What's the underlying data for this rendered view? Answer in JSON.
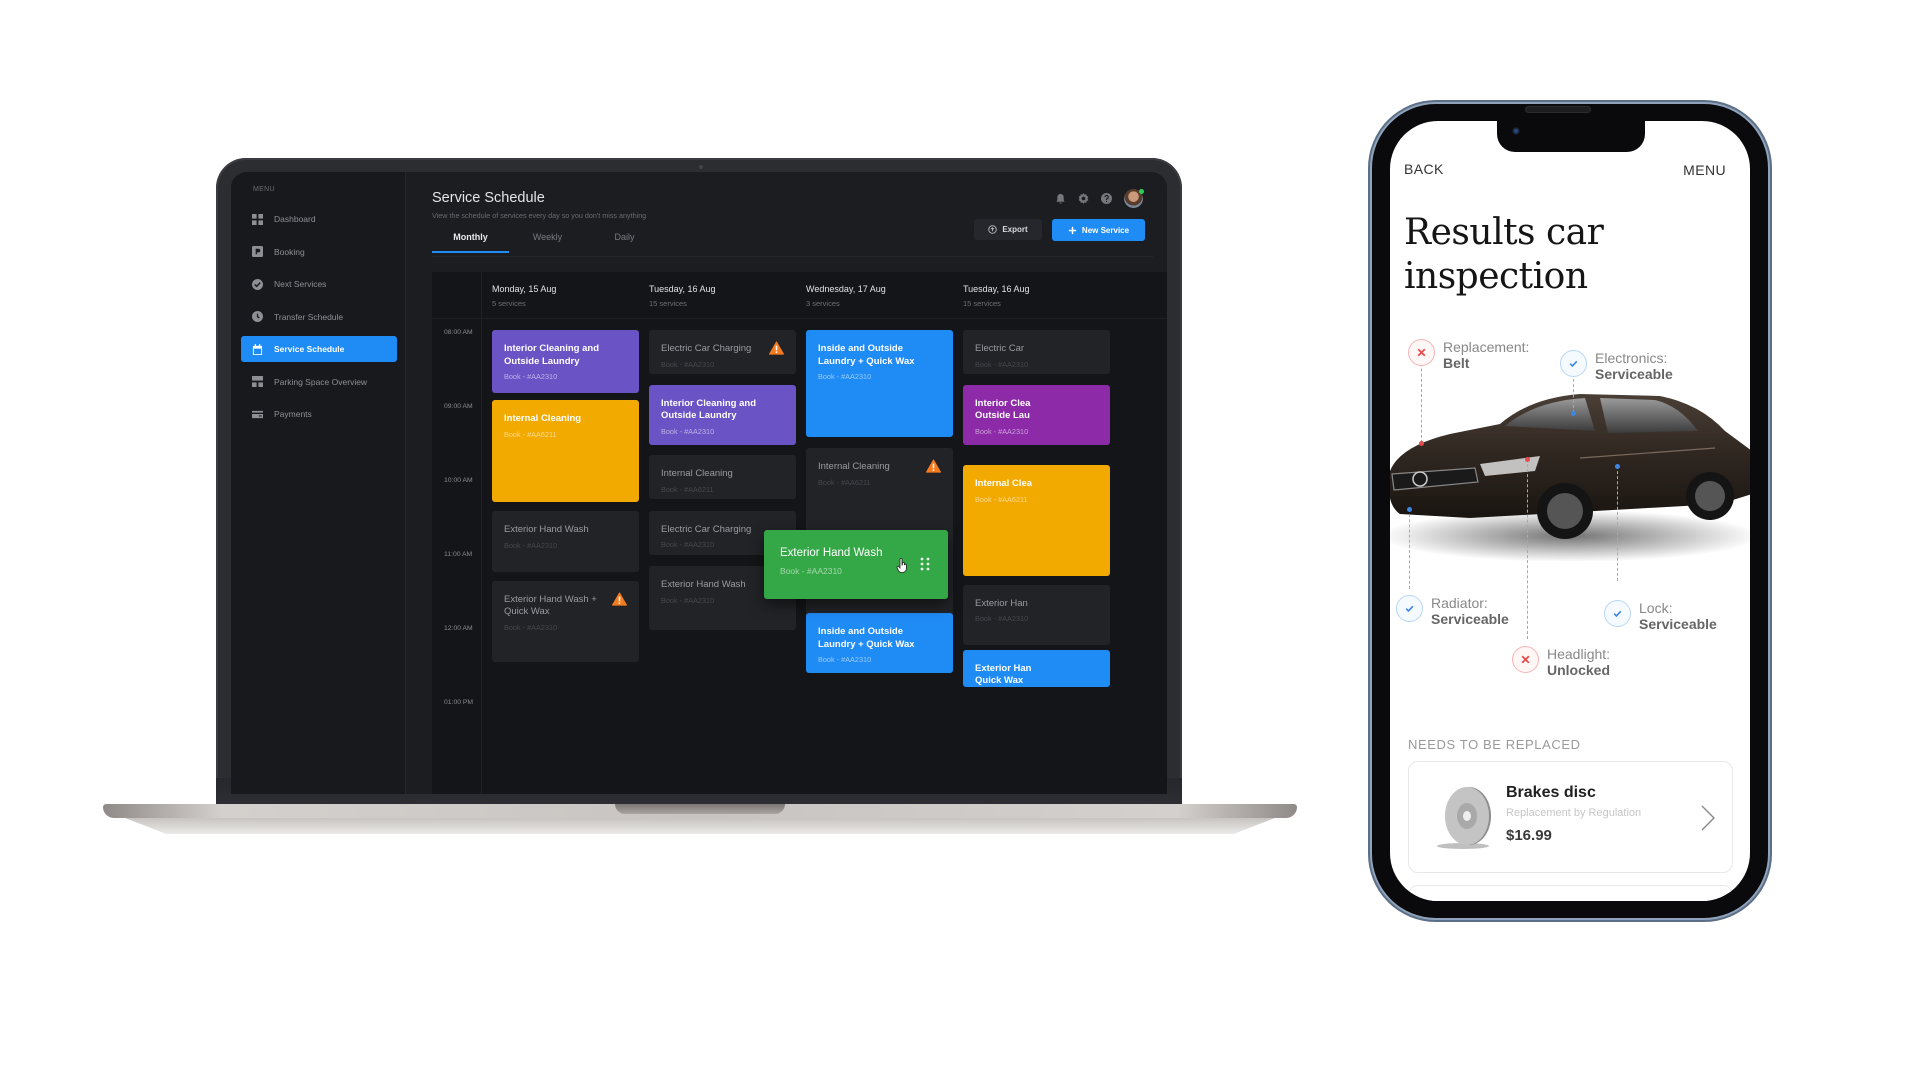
{
  "laptop": {
    "sidebar": {
      "caption": "MENU",
      "items": [
        {
          "label": "Dashboard",
          "icon": "grid-icon",
          "active": false
        },
        {
          "label": "Booking",
          "icon": "parking-icon",
          "active": false
        },
        {
          "label": "Next Services",
          "icon": "check-circle-icon",
          "active": false
        },
        {
          "label": "Transfer Schedule",
          "icon": "clock-icon",
          "active": false
        },
        {
          "label": "Service Schedule",
          "icon": "calendar-icon",
          "active": true
        },
        {
          "label": "Parking Space Overview",
          "icon": "layout-icon",
          "active": false
        },
        {
          "label": "Payments",
          "icon": "card-icon",
          "active": false
        }
      ]
    },
    "header": {
      "title": "Service Schedule",
      "subtitle": "View the schedule of services every day so you don't miss anything",
      "icons": [
        "bell-icon",
        "gear-icon",
        "help-icon",
        "avatar"
      ]
    },
    "tabs": [
      {
        "label": "Monthly",
        "active": true
      },
      {
        "label": "Weekly",
        "active": false
      },
      {
        "label": "Daily",
        "active": false
      }
    ],
    "actions": {
      "export_label": "Export",
      "new_service_label": "New Service"
    },
    "colors": {
      "accent": "#1f8bf5",
      "purple": "#6a53c4",
      "orange": "#f2aa00",
      "green": "#34a846",
      "magenta": "#8d2aa8",
      "warning": "#f47c20"
    },
    "calendar": {
      "times": [
        "08:00 AM",
        "09:00 AM",
        "10:00 AM",
        "11:00 AM",
        "12:00 AM",
        "01:00 PM"
      ],
      "days": [
        {
          "name": "Monday, 15 Aug",
          "count": "5 services",
          "events": [
            {
              "title": "Interior Cleaning and Outside Laundry",
              "book": "Book - #AA2310",
              "color": "purple",
              "warning": false
            },
            {
              "title": "Internal Cleaning",
              "book": "Book - #AA6211",
              "color": "orange",
              "warning": false
            },
            {
              "title": "Exterior Hand Wash",
              "book": "Book - #AA2310",
              "color": "dark",
              "warning": false
            },
            {
              "title": "Exterior Hand Wash + Quick Wax",
              "book": "Book - #AA2310",
              "color": "dark",
              "warning": true
            }
          ]
        },
        {
          "name": "Tuesday, 16 Aug",
          "count": "15 services",
          "events": [
            {
              "title": "Electric Car Charging",
              "book": "Book - #AA2310",
              "color": "dark",
              "warning": true
            },
            {
              "title": "Interior Cleaning and Outside Laundry",
              "book": "Book - #AA2310",
              "color": "purple",
              "warning": false
            },
            {
              "title": "Internal Cleaning",
              "book": "Book - #AA6211",
              "color": "dark",
              "warning": false
            },
            {
              "title": "Electric Car Charging",
              "book": "Book - #AA2310",
              "color": "dark",
              "warning": false
            },
            {
              "title": "Exterior Hand Wash",
              "book": "Book - #AA2310",
              "color": "dark",
              "warning": false
            }
          ]
        },
        {
          "name": "Wednesday, 17 Aug",
          "count": "3 services",
          "events": [
            {
              "title": "Inside and Outside Laundry + Quick Wax",
              "book": "Book - #AA2310",
              "color": "blue",
              "warning": false
            },
            {
              "title": "Internal Cleaning",
              "book": "Book - #AA6211",
              "color": "dark",
              "warning": true
            },
            {
              "title": "Inside and Outside Laundry + Quick Wax",
              "book": "Book - #AA2310",
              "color": "blue",
              "warning": false
            }
          ]
        },
        {
          "name": "Tuesday, 16 Aug",
          "count": "15 services",
          "events": [
            {
              "title": "Electric Car",
              "book": "Book - #AA2310",
              "color": "dark",
              "warning": false
            },
            {
              "title": "Interior Clea Outside Lau",
              "book": "Book - #AA2310",
              "color": "magenta",
              "warning": false
            },
            {
              "title": "Internal Clea",
              "book": "Book - #AA6211",
              "color": "orange",
              "warning": false
            },
            {
              "title": "Exterior Han",
              "book": "Book - #AA2310",
              "color": "dark",
              "warning": false
            },
            {
              "title": "Exterior Han Quick Wax",
              "book": "",
              "color": "blue",
              "warning": false
            }
          ]
        }
      ],
      "dragging": {
        "title": "Exterior Hand Wash",
        "book": "Book - #AA2310",
        "color": "green"
      }
    }
  },
  "phone": {
    "back_label": "BACK",
    "menu_label": "MENU",
    "title": "Results car inspection",
    "inspections": [
      {
        "label": "Replacement:",
        "value": "Belt",
        "status": "fail"
      },
      {
        "label": "Electronics:",
        "value": "Serviceable",
        "status": "ok"
      },
      {
        "label": "Radiator:",
        "value": "Serviceable",
        "status": "ok"
      },
      {
        "label": "Lock:",
        "value": "Serviceable",
        "status": "ok"
      },
      {
        "label": "Headlight:",
        "value": "Unlocked",
        "status": "fail"
      }
    ],
    "section_caption": "NEEDS TO BE REPLACED",
    "parts": [
      {
        "name": "Brakes disc",
        "subtitle": "Replacement by Regulation",
        "price": "$16.99"
      }
    ],
    "colors": {
      "fail": "#e84b4b",
      "ok": "#3d86e6"
    }
  }
}
